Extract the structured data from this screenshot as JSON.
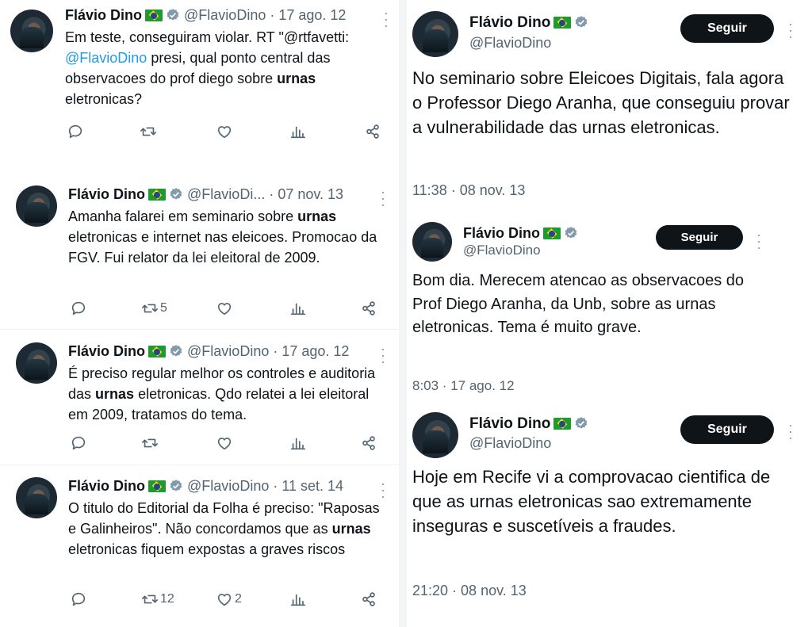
{
  "left_tweets": [
    {
      "name": "Flávio Dino",
      "handle": "@FlavioDino",
      "date": "17 ago. 12",
      "text_html_parts": {
        "p1": "Em teste, conseguiram violar. RT \"@rtfavetti: ",
        "mention": "@FlavioDino",
        "p2": " presi, qual ponto central das observacoes do prof diego sobre ",
        "bold": "urnas",
        "p3": " eletronicas?"
      },
      "retweets": "",
      "likes": ""
    },
    {
      "name": "Flávio Dino",
      "handle": "@FlavioDi...",
      "date": "07 nov. 13",
      "text_html_parts": {
        "p1": "Amanha falarei em seminario sobre ",
        "bold": "urnas",
        "p2": " eletronicas e internet nas eleicoes. Promocao da FGV. Fui relator da lei eleitoral de 2009."
      },
      "retweets": "5",
      "likes": ""
    },
    {
      "name": "Flávio Dino",
      "handle": "@FlavioDino",
      "date": "17 ago. 12",
      "text_html_parts": {
        "p1": "É preciso regular melhor os controles e auditoria das ",
        "bold": "urnas",
        "p2": " eletronicas. Qdo relatei a lei eleitoral em 2009, tratamos do tema."
      },
      "retweets": "",
      "likes": ""
    },
    {
      "name": "Flávio Dino",
      "handle": "@FlavioDino",
      "date": "11 set. 14",
      "text_html_parts": {
        "p1": "O titulo do Editorial da Folha é preciso: \"Raposas e Galinheiros\". Não concordamos que as ",
        "bold": "urnas",
        "p2": " eletronicas fiquem expostas a graves riscos"
      },
      "retweets": "12",
      "likes": "2"
    }
  ],
  "right_tweets": [
    {
      "name": "Flávio Dino",
      "handle": "@FlavioDino",
      "follow_label": "Seguir",
      "text": "No seminario sobre Eleicoes Digitais, fala agora o Professor Diego Aranha, que conseguiu provar a vulnerabilidade das urnas eletronicas.",
      "timestamp": "11:38 · 08 nov. 13"
    },
    {
      "name": "Flávio Dino",
      "handle": "@FlavioDino",
      "follow_label": "Seguir",
      "text": "Bom dia. Merecem atencao as observacoes do Prof Diego Aranha, da Unb, sobre as urnas eletronicas. Tema é muito grave.",
      "timestamp": "8:03 · 17 ago. 12"
    },
    {
      "name": "Flávio Dino",
      "handle": "@FlavioDino",
      "follow_label": "Seguir",
      "text": "Hoje em Recife vi a comprovacao cientifica de que as urnas eletronicas sao extremamente inseguras e suscetíveis a fraudes.",
      "timestamp": "21:20 · 08 nov. 13"
    }
  ],
  "colors": {
    "text": "#0f1419",
    "secondary": "#536471",
    "link": "#1d9bf0",
    "verified": "#829aab",
    "button": "#0f1419"
  },
  "icons": [
    "reply-icon",
    "retweet-icon",
    "like-icon",
    "views-icon",
    "share-icon",
    "verified-icon",
    "flag-brazil-icon",
    "more-icon"
  ]
}
